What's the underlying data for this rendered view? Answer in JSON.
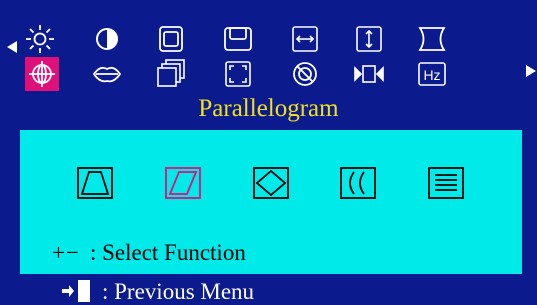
{
  "osd": {
    "colors": {
      "background": "#0b1a8c",
      "panel": "#00eaea",
      "selected": "#e0107a",
      "title": "#f0e020"
    },
    "nav": {
      "left_arrow": "left-arrow-icon",
      "right_arrow": "right-arrow-icon"
    },
    "top_icons": [
      {
        "name": "brightness-icon",
        "selected": false
      },
      {
        "name": "contrast-icon",
        "selected": false
      },
      {
        "name": "h-position-icon",
        "selected": false
      },
      {
        "name": "v-position-icon",
        "selected": false
      },
      {
        "name": "h-size-icon",
        "selected": false
      },
      {
        "name": "v-size-icon",
        "selected": false
      },
      {
        "name": "pincushion-icon",
        "selected": false
      },
      {
        "name": "geometry-icon",
        "selected": true
      },
      {
        "name": "moire-icon",
        "selected": false
      },
      {
        "name": "multi-window-icon",
        "selected": false
      },
      {
        "name": "zoom-icon",
        "selected": false
      },
      {
        "name": "degauss-icon",
        "selected": false
      },
      {
        "name": "recall-icon",
        "selected": false
      },
      {
        "name": "frequency-hz-icon",
        "selected": false
      }
    ],
    "hz_label": "Hz",
    "title": "Parallelogram",
    "sub_icons": [
      {
        "name": "trapezoid-icon",
        "selected": false
      },
      {
        "name": "parallelogram-icon",
        "selected": true
      },
      {
        "name": "rotation-icon",
        "selected": false
      },
      {
        "name": "pinbalance-icon",
        "selected": false
      },
      {
        "name": "linearity-icon",
        "selected": false
      }
    ],
    "help": [
      {
        "keys": "+−",
        "separator": ":",
        "text": "Select Function"
      },
      {
        "keys": "",
        "separator": ":",
        "text": "Previous Menu"
      }
    ]
  }
}
